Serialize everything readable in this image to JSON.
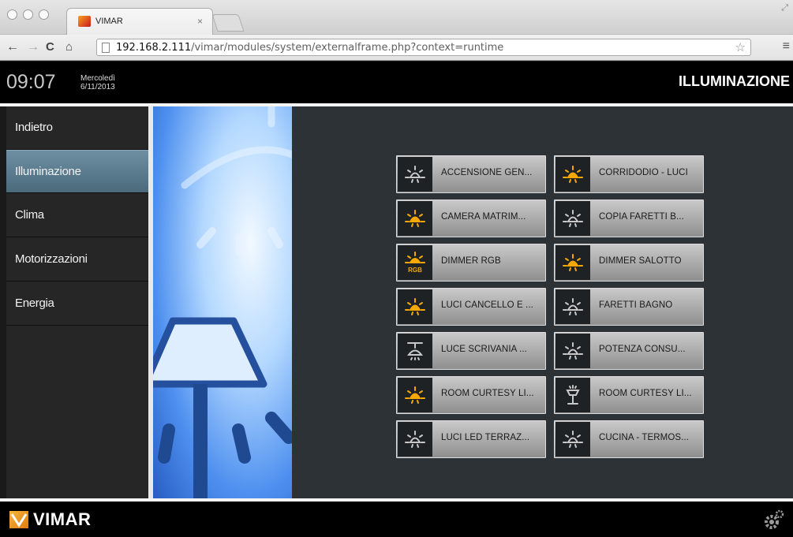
{
  "browser": {
    "tab_title": "VIMAR",
    "tab_close": "×",
    "url_host": "192.168.2.111",
    "url_path": "/vimar/modules/system/externalframe.php?context=runtime"
  },
  "header": {
    "time": "09:07",
    "day": "Mercoledì",
    "date": "6/11/2013",
    "title": "ILLUMINAZIONE"
  },
  "sidebar": {
    "items": [
      {
        "label": "Indietro",
        "active": false
      },
      {
        "label": "Illuminazione",
        "active": true
      },
      {
        "label": "Clima",
        "active": false
      },
      {
        "label": "Motorizzazioni",
        "active": false
      },
      {
        "label": "Energia",
        "active": false
      }
    ]
  },
  "lights": [
    {
      "label": "ACCENSIONE GEN...",
      "icon": "bulb-icon",
      "on": false
    },
    {
      "label": "CORRIDODIO - LUCI",
      "icon": "bulb-icon",
      "on": true
    },
    {
      "label": "CAMERA MATRIM...",
      "icon": "bulb-icon",
      "on": true
    },
    {
      "label": "COPIA FARETTI B...",
      "icon": "bulb-icon",
      "on": false
    },
    {
      "label": "DIMMER RGB",
      "icon": "rgb-bulb-icon",
      "on": true,
      "icon_text": "RGB"
    },
    {
      "label": "DIMMER SALOTTO",
      "icon": "bulb-icon",
      "on": true
    },
    {
      "label": "LUCI CANCELLO E ...",
      "icon": "bulb-icon",
      "on": true
    },
    {
      "label": "FARETTI BAGNO",
      "icon": "bulb-icon",
      "on": false
    },
    {
      "label": "LUCE SCRIVANIA ...",
      "icon": "pendant-lamp-icon",
      "on": false
    },
    {
      "label": "POTENZA CONSU...",
      "icon": "bulb-icon",
      "on": false
    },
    {
      "label": "ROOM CURTESY LI...",
      "icon": "bulb-icon",
      "on": true
    },
    {
      "label": "ROOM CURTESY LI...",
      "icon": "floor-lamp-icon",
      "on": false
    },
    {
      "label": "LUCI LED TERRAZ...",
      "icon": "bulb-icon",
      "on": false
    },
    {
      "label": "CUCINA - TERMOS...",
      "icon": "bulb-icon",
      "on": false
    }
  ],
  "footer": {
    "brand": "VIMAR"
  },
  "colors": {
    "on": "#f5a800",
    "off": "#c8c8c8",
    "accent": "#5a7b8e"
  }
}
